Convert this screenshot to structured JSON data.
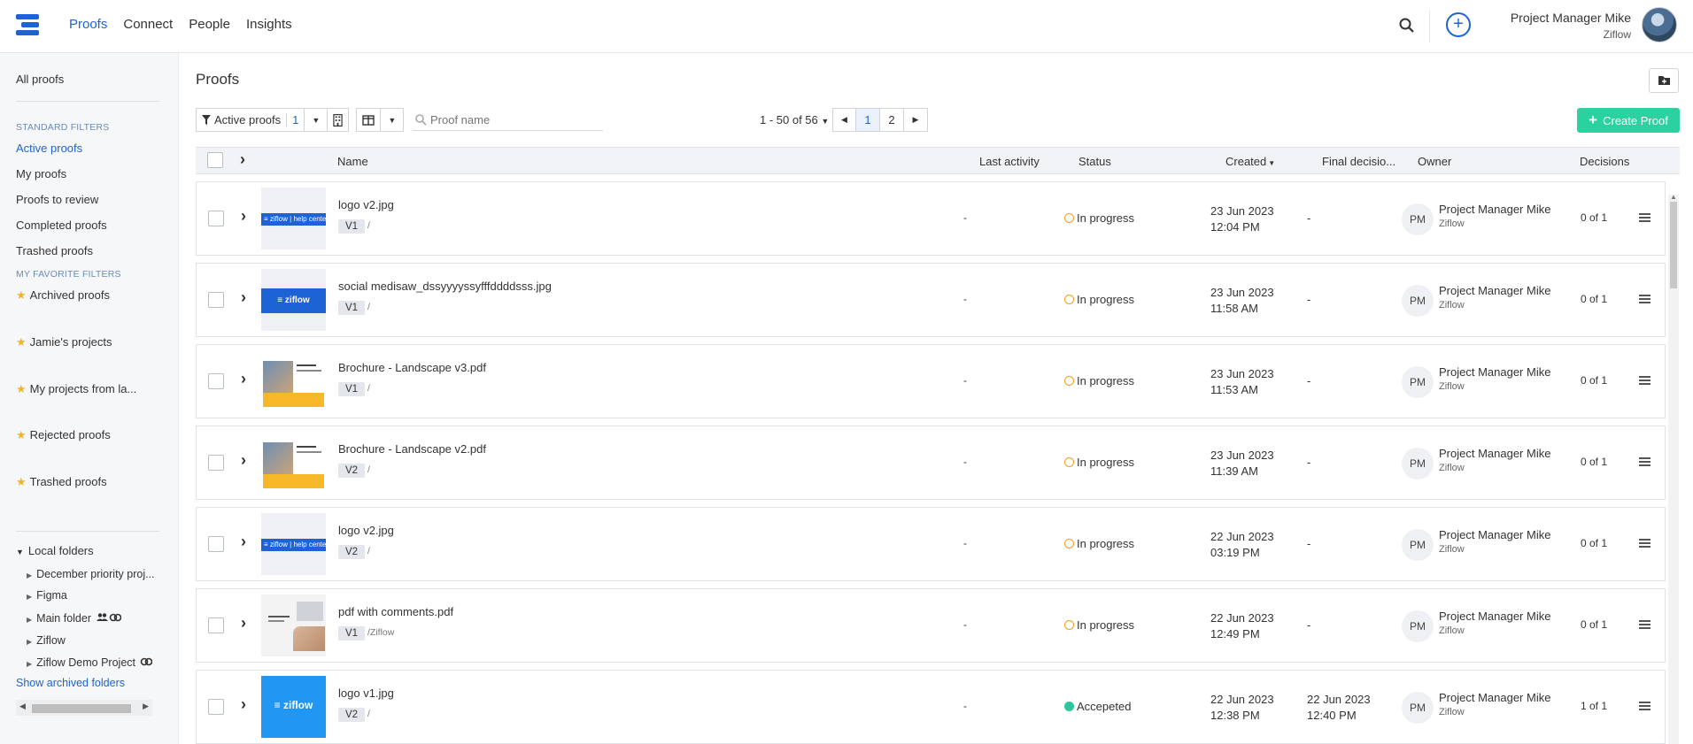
{
  "nav": {
    "items": [
      "Proofs",
      "Connect",
      "People",
      "Insights"
    ],
    "active": "Proofs"
  },
  "user": {
    "name": "Project Manager Mike",
    "org": "Ziflow"
  },
  "sidebar": {
    "all": "All proofs",
    "standard_head": "STANDARD FILTERS",
    "standard": [
      "Active proofs",
      "My proofs",
      "Proofs to review",
      "Completed proofs",
      "Trashed proofs"
    ],
    "favorite_head": "MY FAVORITE FILTERS",
    "favorites": [
      "Archived proofs",
      "Jamie's projects",
      "My projects from la...",
      "Rejected proofs",
      "Trashed proofs"
    ],
    "local_folders": "Local folders",
    "folders": [
      "December priority proj...",
      "Figma",
      "Main folder",
      "Ziflow",
      "Ziflow Demo Project"
    ],
    "show_archived": "Show archived folders"
  },
  "main": {
    "title": "Proofs",
    "filter_label": "Active proofs",
    "filter_count": "1",
    "search_placeholder": "Proof name",
    "pagination_text": "1 - 50 of 56",
    "pages": [
      "1",
      "2"
    ],
    "create_label": "Create Proof"
  },
  "columns": {
    "name": "Name",
    "last_activity": "Last activity",
    "status": "Status",
    "created": "Created",
    "final_decision": "Final decisio...",
    "owner": "Owner",
    "decisions": "Decisions"
  },
  "rows": [
    {
      "name": "logo v2.jpg",
      "version": "V1",
      "path": "/",
      "last": "-",
      "status": "In progress",
      "created_date": "23 Jun 2023",
      "created_time": "12:04 PM",
      "final": "-",
      "final_time": "",
      "owner_initials": "PM",
      "owner": "Project Manager Mike",
      "owner_org": "Ziflow",
      "decisions": "0 of 1"
    },
    {
      "name": "social medisaw_dssyyyyssyfffddddsss.jpg",
      "version": "V1",
      "path": "/",
      "last": "-",
      "status": "In progress",
      "created_date": "23 Jun 2023",
      "created_time": "11:58 AM",
      "final": "-",
      "final_time": "",
      "owner_initials": "PM",
      "owner": "Project Manager Mike",
      "owner_org": "Ziflow",
      "decisions": "0 of 1"
    },
    {
      "name": "Brochure - Landscape v3.pdf",
      "version": "V1",
      "path": "/",
      "last": "-",
      "status": "In progress",
      "created_date": "23 Jun 2023",
      "created_time": "11:53 AM",
      "final": "-",
      "final_time": "",
      "owner_initials": "PM",
      "owner": "Project Manager Mike",
      "owner_org": "Ziflow",
      "decisions": "0 of 1"
    },
    {
      "name": "Brochure - Landscape v2.pdf",
      "version": "V2",
      "path": "/",
      "last": "-",
      "status": "In progress",
      "created_date": "23 Jun 2023",
      "created_time": "11:39 AM",
      "final": "-",
      "final_time": "",
      "owner_initials": "PM",
      "owner": "Project Manager Mike",
      "owner_org": "Ziflow",
      "decisions": "0 of 1"
    },
    {
      "name": "logo v2.jpg",
      "version": "V2",
      "path": "/",
      "last": "-",
      "status": "In progress",
      "created_date": "22 Jun 2023",
      "created_time": "03:19 PM",
      "final": "-",
      "final_time": "",
      "owner_initials": "PM",
      "owner": "Project Manager Mike",
      "owner_org": "Ziflow",
      "decisions": "0 of 1"
    },
    {
      "name": "pdf with comments.pdf",
      "version": "V1",
      "path": "/Ziflow",
      "last": "-",
      "status": "In progress",
      "created_date": "22 Jun 2023",
      "created_time": "12:49 PM",
      "final": "-",
      "final_time": "",
      "owner_initials": "PM",
      "owner": "Project Manager Mike",
      "owner_org": "Ziflow",
      "decisions": "0 of 1"
    },
    {
      "name": "logo v1.jpg",
      "version": "V2",
      "path": "/",
      "last": "-",
      "status": "Accepeted",
      "created_date": "22 Jun 2023",
      "created_time": "12:38 PM",
      "final": "22 Jun 2023",
      "final_time": "12:40 PM",
      "owner_initials": "PM",
      "owner": "Project Manager Mike",
      "owner_org": "Ziflow",
      "decisions": "1 of 1"
    }
  ],
  "thumb_logo_text": "ziflow",
  "thumb_logo_suffix": "help center"
}
